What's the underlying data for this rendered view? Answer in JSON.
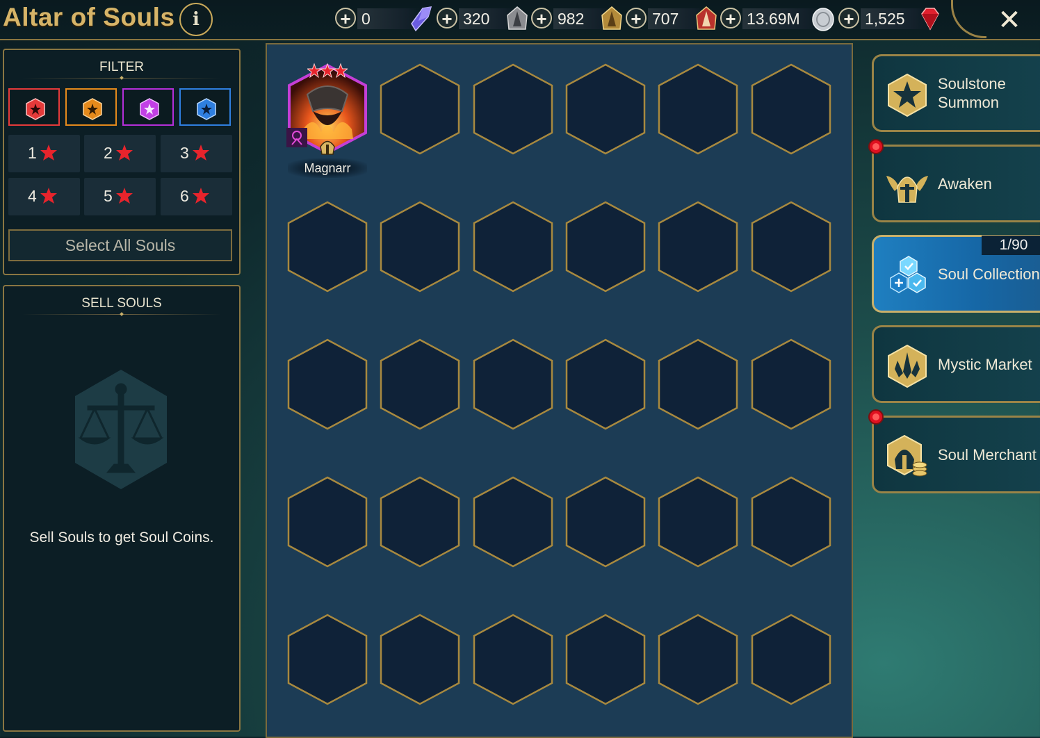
{
  "header": {
    "title": "Altar of Souls",
    "info_icon": "info-icon",
    "close_icon": "close-icon"
  },
  "resources": [
    {
      "id": "energy-crystal",
      "value": "0",
      "icon": "purple-crystal-icon"
    },
    {
      "id": "ancient-shard",
      "value": "320",
      "icon": "ancient-shard-icon"
    },
    {
      "id": "void-shard",
      "value": "982",
      "icon": "void-shard-icon"
    },
    {
      "id": "sacred-shard",
      "value": "707",
      "icon": "sacred-shard-icon"
    },
    {
      "id": "silver",
      "value": "13.69M",
      "icon": "silver-coin-icon"
    },
    {
      "id": "gems",
      "value": "1,525",
      "icon": "ruby-gem-icon"
    }
  ],
  "filter": {
    "heading": "FILTER",
    "rarities": [
      {
        "name": "legendary",
        "color": "#e53a3a"
      },
      {
        "name": "epic",
        "color": "#e58a1c"
      },
      {
        "name": "rare-purple",
        "color": "#b42fd8"
      },
      {
        "name": "rare-blue",
        "color": "#2f7fe0"
      }
    ],
    "stars": [
      "1",
      "2",
      "3",
      "4",
      "5",
      "6"
    ],
    "select_all": "Select All Souls"
  },
  "sell": {
    "heading": "SELL SOULS",
    "hint": "Sell Souls to get Soul Coins."
  },
  "grid": {
    "slots_total": 30,
    "souls": [
      {
        "name": "Magnarr",
        "stars": 3,
        "frame_color": "#c43fd6"
      }
    ]
  },
  "nav": {
    "soulstone_summon": "Soulstone Summon",
    "awaken": "Awaken",
    "soul_collection": "Soul Collection",
    "soul_collection_count": "1/90",
    "mystic_market": "Mystic Market",
    "soul_merchant": "Soul Merchant"
  },
  "colors": {
    "accent_gold": "#c9a95a",
    "grid_bg": "#1c3c55",
    "active_nav": "#1f7fc0",
    "notification_red": "#e01020"
  }
}
